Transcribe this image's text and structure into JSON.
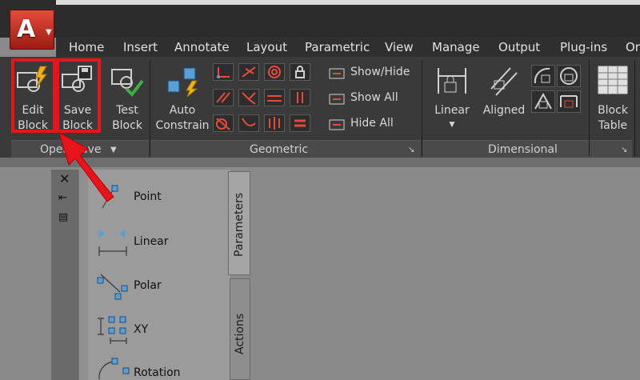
{
  "ribbon_tabs": [
    "Home",
    "Insert",
    "Annotate",
    "Layout",
    "Parametric",
    "View",
    "Manage",
    "Output",
    "Plug-ins",
    "Or"
  ],
  "open_save": {
    "edit_block": [
      "Edit",
      "Block"
    ],
    "save_block": [
      "Save",
      "Block"
    ],
    "test_block": [
      "Test",
      "Block"
    ],
    "panel_label": "Open/Save"
  },
  "geometric": {
    "auto_constrain": [
      "Auto",
      "Constrain"
    ],
    "show_hide": "Show/Hide",
    "show_all": "Show All",
    "hide_all": "Hide All",
    "panel_label": "Geometric"
  },
  "dimensional": {
    "linear": "Linear",
    "aligned": "Aligned",
    "panel_label": "Dimensional"
  },
  "block_table": [
    "Block",
    "Table"
  ],
  "palette": {
    "items": [
      "Point",
      "Linear",
      "Polar",
      "XY",
      "Rotation"
    ],
    "tab_parameters": "Parameters",
    "tab_actions": "Actions"
  },
  "colors": {
    "highlight": "#e8141b",
    "ribbon_bg": "#3a3a3a",
    "accent_blue": "#5a9fd4"
  }
}
